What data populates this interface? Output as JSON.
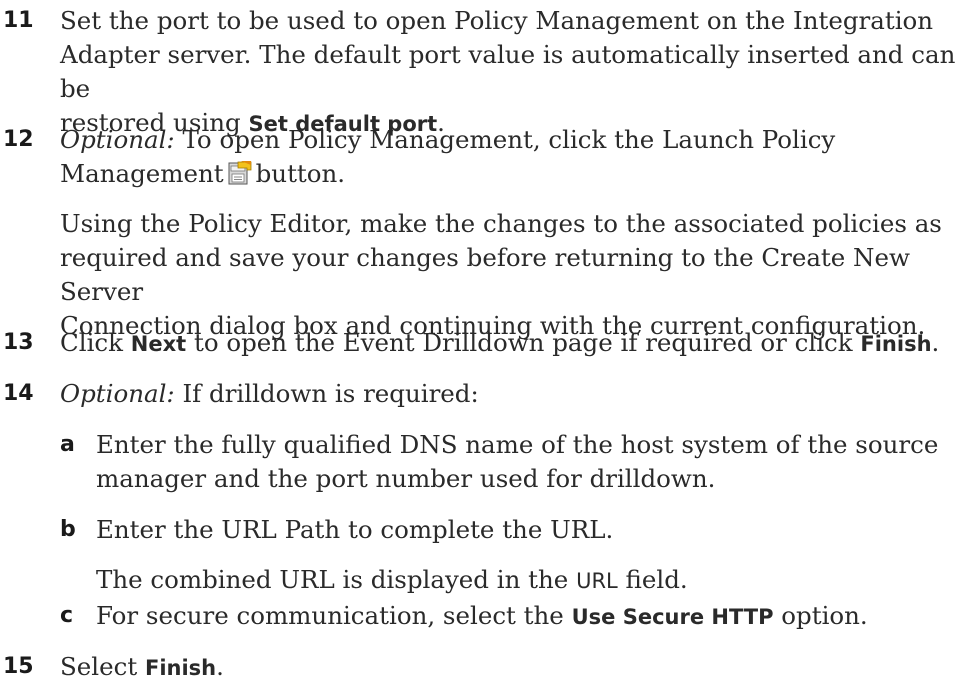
{
  "steps": {
    "s11": {
      "num": "11",
      "t1": "Set the port to be used to open Policy Management on the Integration",
      "t2": "Adapter server. The default port value is automatically inserted and can be",
      "t3a": "restored using ",
      "t3b": "Set default port",
      "t3c": "."
    },
    "s12": {
      "num": "12",
      "opt": "Optional:",
      "t1": " To open Policy Management, click the Launch Policy",
      "t2a": "Management",
      "t2b": "button.",
      "p1": "Using the Policy Editor, make the changes to the associated policies as",
      "p2": "required and save your changes before returning to the Create New Server",
      "p3": "Connection dialog box and continuing with the current configuration."
    },
    "s13": {
      "num": "13",
      "a": "Click ",
      "b": "Next",
      "c": " to open the Event Drilldown page if required or click ",
      "d": "Finish",
      "e": "."
    },
    "s14": {
      "num": "14",
      "opt": "Optional:",
      "t": " If drilldown is required:",
      "a": {
        "letter": "a",
        "l1": "Enter the fully qualified DNS name of the host system of the source",
        "l2": "manager and the port number used for drilldown."
      },
      "b": {
        "letter": "b",
        "l1": "Enter the URL Path to complete the URL.",
        "l2a": "The combined URL is displayed in the ",
        "l2b": "URL",
        "l2c": " field."
      },
      "c": {
        "letter": "c",
        "l1a": "For secure communication, select the ",
        "l1b": "Use Secure HTTP",
        "l1c": " option."
      }
    },
    "s15": {
      "num": "15",
      "a": "Select ",
      "b": "Finish",
      "c": "."
    }
  },
  "icons": {
    "launch_policy": "launch-policy-management-icon"
  }
}
